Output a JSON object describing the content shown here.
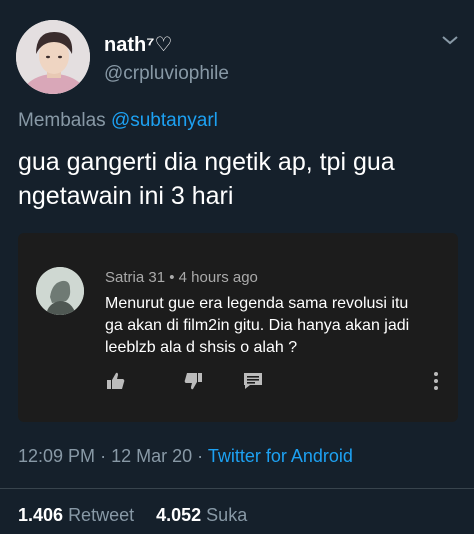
{
  "author": {
    "display_name": "nath⁷♡",
    "username": "@crpluviophile"
  },
  "reply": {
    "prefix": "Membalas",
    "mention": "@subtanyarl"
  },
  "tweet_text": "gua gangerti dia ngetik ap, tpi gua ngetawain ini 3 hari",
  "comment_card": {
    "commenter": "Satria 31",
    "separator": "•",
    "time_ago": "4 hours ago",
    "text": "Menurut gue era legenda sama revolusi itu ga akan di film2in gitu. Dia hanya akan jadi leeblzb ala d shsis o alah ?",
    "icons": [
      "thumbs-up-icon",
      "thumbs-down-icon",
      "comment-icon",
      "more-vertical-icon"
    ]
  },
  "footer": {
    "time": "12:09 PM",
    "dot1": "·",
    "date": "12 Mar 20",
    "dot2": "·",
    "source": "Twitter for Android"
  },
  "stats": {
    "retweets_count": "1.406",
    "retweets_label": "Retweet",
    "likes_count": "4.052",
    "likes_label": "Suka"
  },
  "colors": {
    "background": "#15202b",
    "link": "#1da1f2",
    "secondary_text": "#8899a6",
    "card_background": "#1c1c1c"
  }
}
